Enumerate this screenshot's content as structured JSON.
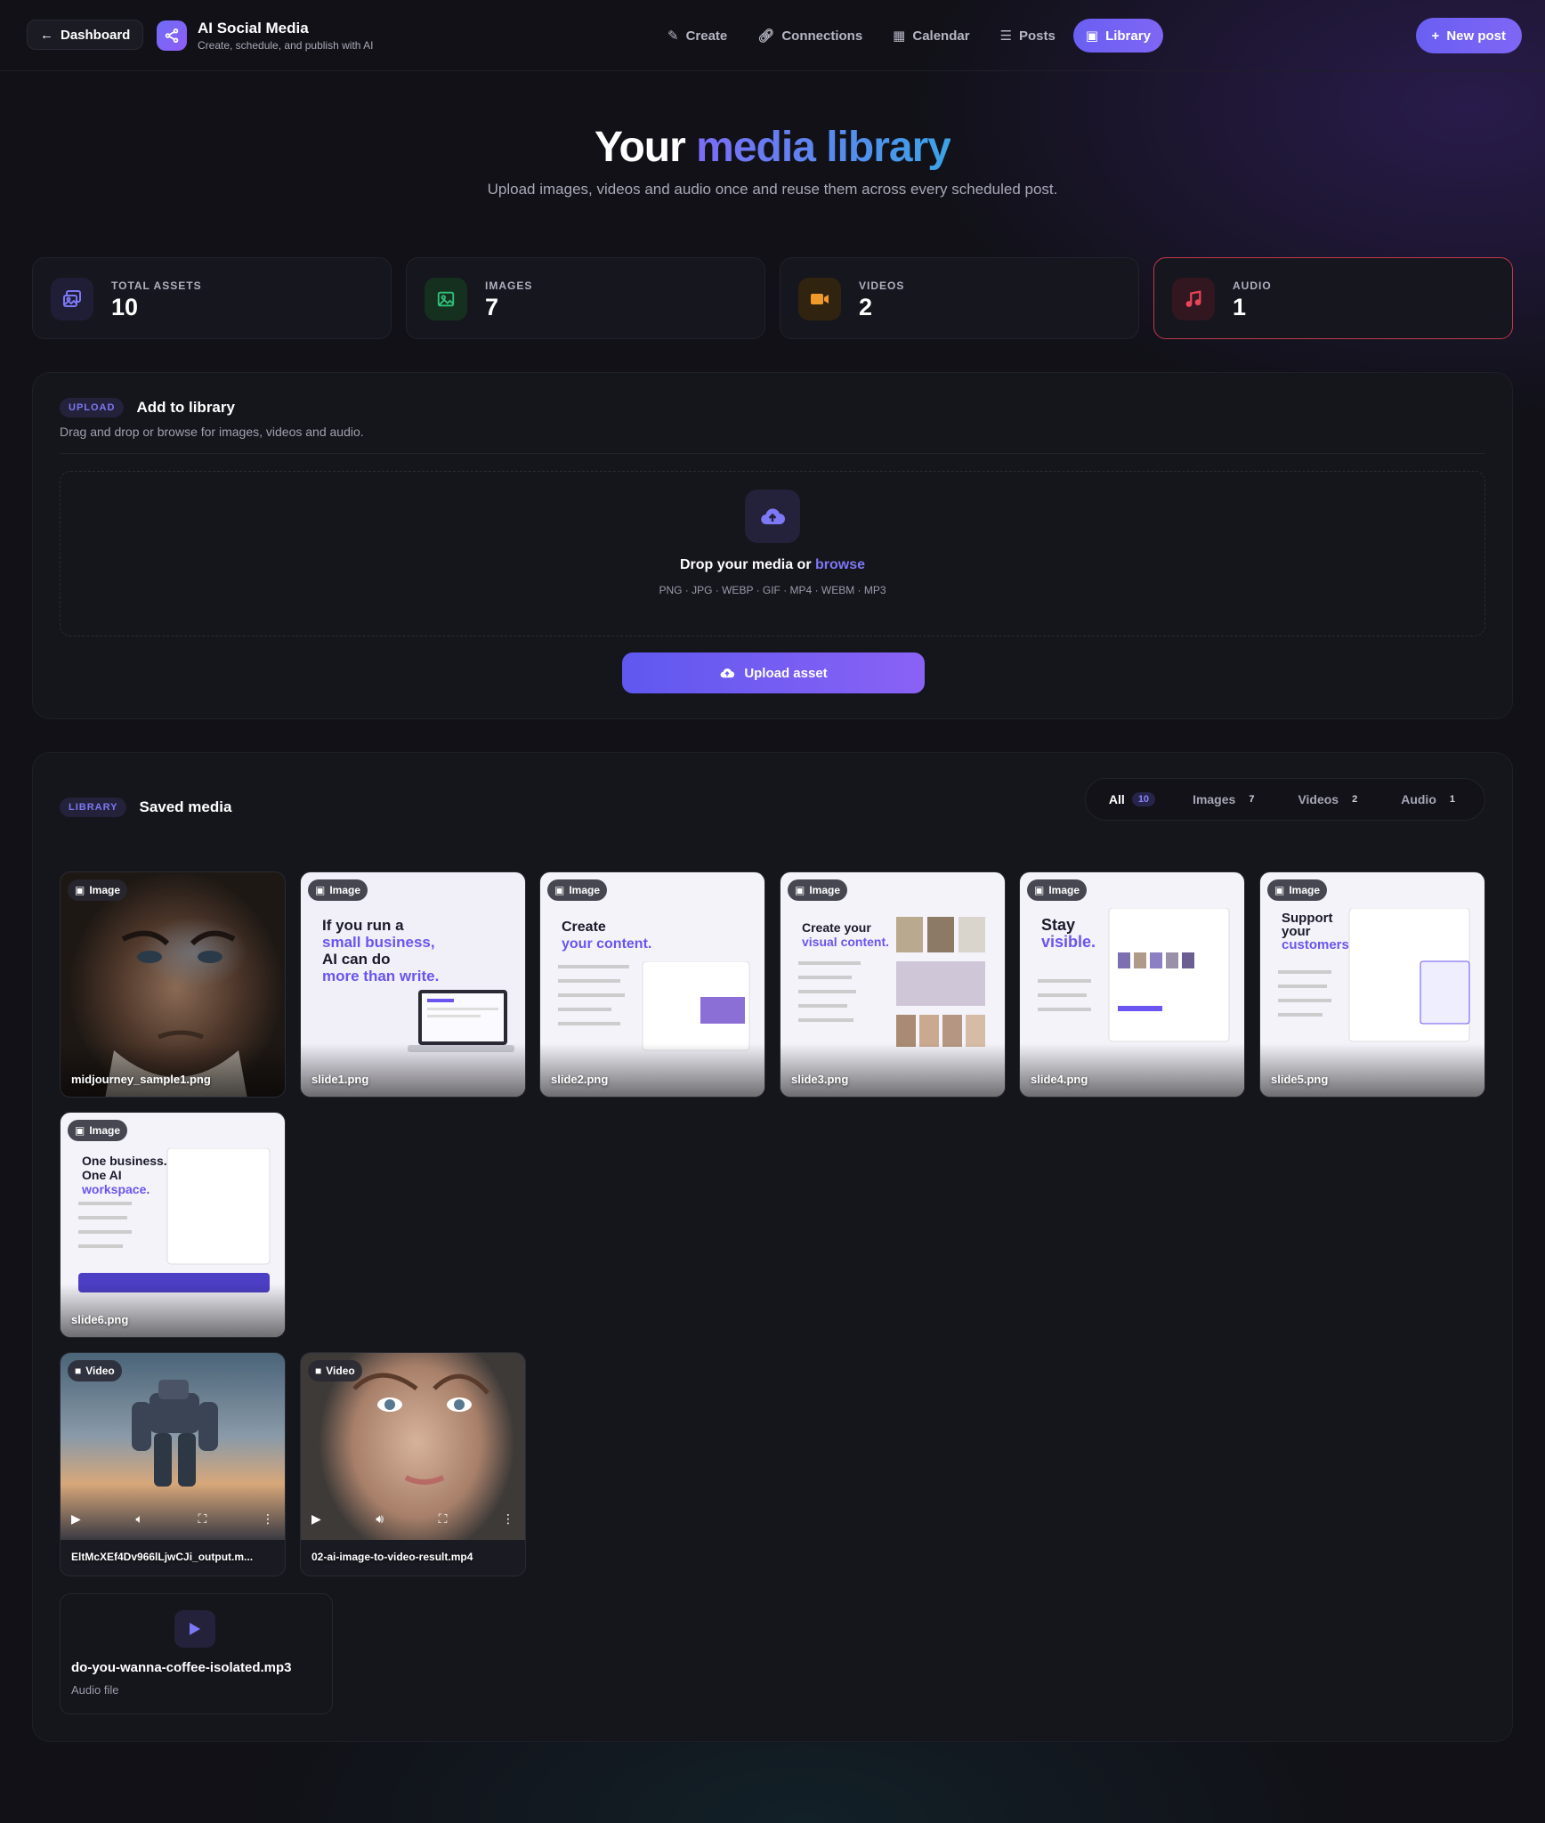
{
  "header": {
    "back_label": "Dashboard",
    "brand_title": "AI Social Media",
    "brand_subtitle": "Create, schedule, and publish with AI",
    "nav": [
      {
        "label": "Create",
        "icon": "edit-icon"
      },
      {
        "label": "Connections",
        "icon": "link-icon"
      },
      {
        "label": "Calendar",
        "icon": "calendar-icon"
      },
      {
        "label": "Posts",
        "icon": "list-icon"
      },
      {
        "label": "Library",
        "icon": "images-icon",
        "active": true
      }
    ],
    "new_post_label": "New post"
  },
  "hero": {
    "title_prefix": "Your",
    "title_accent": "media library",
    "subtitle": "Upload images, videos and audio once and reuse them across every scheduled post."
  },
  "stats": [
    {
      "label": "TOTAL ASSETS",
      "value": "10",
      "icon": "images-icon",
      "color": "#7d78f5"
    },
    {
      "label": "IMAGES",
      "value": "7",
      "icon": "image-icon",
      "color": "#2fc27a"
    },
    {
      "label": "VIDEOS",
      "value": "2",
      "icon": "video-icon",
      "color": "#f09a2a"
    },
    {
      "label": "AUDIO",
      "value": "1",
      "icon": "music-icon",
      "color": "#e8455a"
    }
  ],
  "upload": {
    "tag": "UPLOAD",
    "title": "Add to library",
    "subtitle": "Drag and drop or browse for images, videos and audio.",
    "drop_text": "Drop your media or",
    "drop_link": "browse",
    "formats": "PNG · JPG · WEBP · GIF · MP4 · WEBM · MP3",
    "button_label": "Upload asset"
  },
  "library": {
    "tag": "LIBRARY",
    "title": "Saved media",
    "filters": [
      {
        "label": "All",
        "count": "10",
        "active": true
      },
      {
        "label": "Images",
        "count": "7"
      },
      {
        "label": "Videos",
        "count": "2"
      },
      {
        "label": "Audio",
        "count": "1"
      }
    ],
    "images": [
      {
        "badge": "Image",
        "filename": "midjourney_sample1.png"
      },
      {
        "badge": "Image",
        "filename": "slide1.png",
        "headline": [
          "If you run a",
          "small business,",
          "AI can do",
          "more than write."
        ]
      },
      {
        "badge": "Image",
        "filename": "slide2.png",
        "headline": [
          "Create",
          "your content."
        ]
      },
      {
        "badge": "Image",
        "filename": "slide3.png",
        "headline": [
          "Create your",
          "visual content."
        ]
      },
      {
        "badge": "Image",
        "filename": "slide4.png",
        "headline": [
          "Stay",
          "visible."
        ]
      },
      {
        "badge": "Image",
        "filename": "slide5.png",
        "headline": [
          "Support",
          "your",
          "customers."
        ]
      },
      {
        "badge": "Image",
        "filename": "slide6.png",
        "headline": [
          "One business.",
          "One AI",
          "workspace."
        ]
      }
    ],
    "videos": [
      {
        "badge": "Video",
        "filename": "EltMcXEf4Dv966lLjwCJi_output.m..."
      },
      {
        "badge": "Video",
        "filename": "02-ai-image-to-video-result.mp4"
      }
    ],
    "audio": {
      "filename": "do-you-wanna-coffee-isolated.mp3",
      "type": "Audio file"
    }
  }
}
